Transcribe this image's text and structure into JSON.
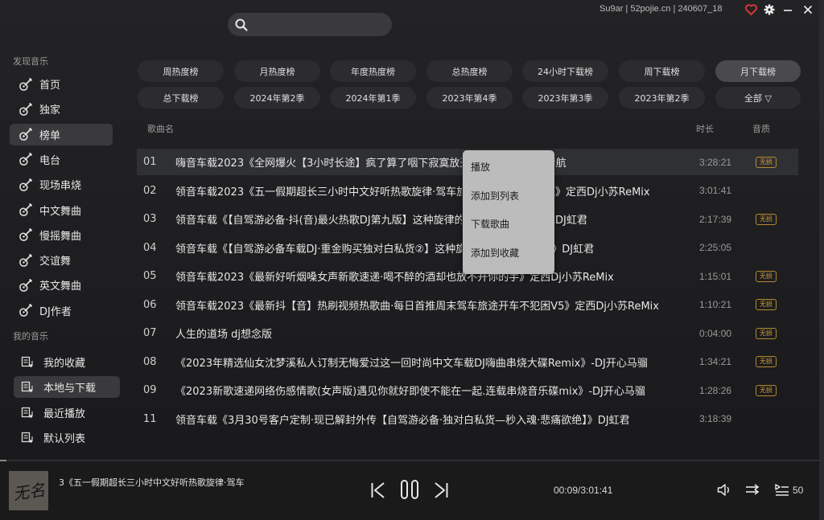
{
  "titlebar": {
    "search_placeholder": "",
    "version": "Su9ar | 52pojie.cn | 240607_18"
  },
  "sidebar": {
    "discover_title": "发现音乐",
    "discover_items": [
      {
        "label": "首页",
        "icon": "guitar-icon"
      },
      {
        "label": "独家",
        "icon": "guitar-icon"
      },
      {
        "label": "榜单",
        "icon": "guitar-icon",
        "active": true
      },
      {
        "label": "电台",
        "icon": "guitar-icon"
      },
      {
        "label": "现场串烧",
        "icon": "guitar-icon"
      },
      {
        "label": "中文舞曲",
        "icon": "guitar-icon"
      },
      {
        "label": "慢摇舞曲",
        "icon": "guitar-icon"
      },
      {
        "label": "交谊舞",
        "icon": "guitar-icon"
      },
      {
        "label": "英文舞曲",
        "icon": "guitar-icon"
      },
      {
        "label": "DJ作者",
        "icon": "guitar-icon"
      }
    ],
    "my_title": "我的音乐",
    "my_items": [
      {
        "label": "我的收藏",
        "icon": "music-list-icon"
      },
      {
        "label": "本地与下载",
        "icon": "music-list-icon",
        "active": true
      },
      {
        "label": "最近播放",
        "icon": "music-list-icon"
      },
      {
        "label": "默认列表",
        "icon": "music-list-icon"
      }
    ]
  },
  "charts": {
    "row1": [
      "周热度榜",
      "月热度榜",
      "年度热度榜",
      "总热度榜",
      "24小时下载榜",
      "周下载榜",
      "月下载榜"
    ],
    "row2": [
      "总下载榜",
      "2024年第2季",
      "2024年第1季",
      "2023年第4季",
      "2023年第3季",
      "2023年第2季",
      "全部 ▽"
    ],
    "active": "月下载榜"
  },
  "list": {
    "col_song": "歌曲名",
    "col_duration": "时长",
    "col_quality": "音质",
    "badge_label": "无损",
    "rows": [
      {
        "idx": "01",
        "title": "嗨音车载2023《全网爆火【3小时长途】疯了算了咽下寂寞放开我",
        "title_tail": "河南Dj彦航",
        "duration": "3:28:21",
        "lossless": true
      },
      {
        "idx": "02",
        "title": "领音车载2023《五一假期超长三小时中文好听热歌旋律·驾车旅",
        "title_tail": "载精华版》定西Dj小苏ReMix",
        "duration": "3:01:41",
        "lossless": false
      },
      {
        "idx": "03",
        "title": "领音车载《【自驾游必备·抖(音)最火热歌DJ第九版】这种旋律的",
        "title_tail": "市》颍上DJ虹君",
        "duration": "2:17:39",
        "lossless": true
      },
      {
        "idx": "04",
        "title": "领音车载《【自驾游必备车载DJ·重金购买独对白私货②】这种旋",
        "title_tail": "3第三版》DJ虹君",
        "duration": "2:25:05",
        "lossless": false
      },
      {
        "idx": "05",
        "title": "领音车载2023《最新好听烟嗓女声新歌速递·喝不醉的酒却也放不开你的手》定西Dj小苏ReMix",
        "title_tail": "",
        "duration": "1:15:01",
        "lossless": true
      },
      {
        "idx": "06",
        "title": "领音车载2023《最新抖【音】热刷视频热歌曲·每日首推周末驾车旅途开车不犯困V5》定西Dj小苏ReMix",
        "title_tail": "",
        "duration": "1:10:21",
        "lossless": true
      },
      {
        "idx": "07",
        "title": "人生的道场 dj想念版",
        "title_tail": "",
        "duration": "0:04:00",
        "lossless": true
      },
      {
        "idx": "08",
        "title": "《2023年精选仙女沈梦溪私人订制无悔爱过这一回时尚中文车载DJ嗨曲串烧大碟Remix》-DJ开心马骝",
        "title_tail": "",
        "duration": "1:34:21",
        "lossless": true
      },
      {
        "idx": "09",
        "title": "《2023新歌速递网络伤感情歌(女声版)遇见你就好即使不能在一起.连载串烧音乐碟mix》-DJ开心马骝",
        "title_tail": "",
        "duration": "1:28:26",
        "lossless": true
      },
      {
        "idx": "11",
        "title": "领音车载《3月30号客户定制·现已解封外传【自驾游必备·独对白私货—秒入魂·悲痛欲绝】》DJ虹君",
        "title_tail": "",
        "duration": "3:18:39",
        "lossless": false
      }
    ]
  },
  "context_menu": {
    "items": [
      "播放",
      "添加到列表",
      "下载歌曲",
      "添加到收藏"
    ]
  },
  "player": {
    "cover_text": "无名",
    "now_playing": "3《五一假期超长三小时中文好听热歌旋律·驾车",
    "time": "00:09/3:01:41",
    "queue_count": "50",
    "progress": 0.0005
  },
  "colors": {
    "background": "#1d1d1f",
    "accent_heart": "#e53935",
    "badge": "#c8993a"
  }
}
